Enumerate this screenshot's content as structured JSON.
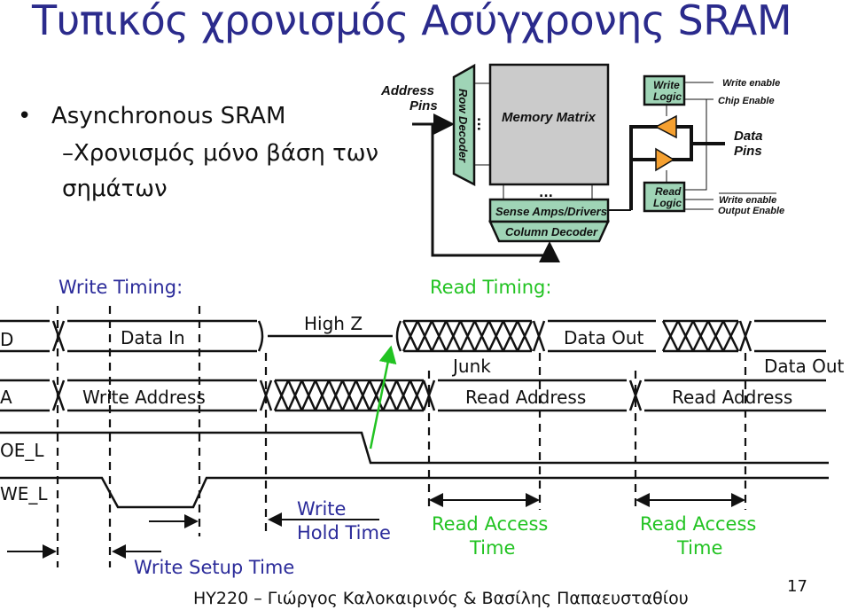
{
  "slide": {
    "title": "Τυπικός χρονισμός Ασύγχρονης SRAM",
    "bullet": "Asynchronous SRAM",
    "sub_bullet_line1": "–Χρονισμός μόνο βάση των",
    "sub_bullet_line2": "σημάτων",
    "footer": "ΗΥ220 – Γιώργος Καλοκαιρινός & Βασίλης Παπαευσταθίου",
    "page_number": "17",
    "title_color": "#2b2b8c"
  },
  "block_diagram": {
    "address_pins": [
      "Address",
      "Pins"
    ],
    "row_decoder": "Row Decoder",
    "memory_matrix": "Memory Matrix",
    "sense_amps": "Sense Amps/Drivers",
    "column_decoder": "Column Decoder",
    "write_logic": [
      "Write",
      "Logic"
    ],
    "read_logic": [
      "Read",
      "Logic"
    ],
    "data_pins": [
      "Data",
      "Pins"
    ],
    "write_enable": "Write enable",
    "chip_enable": "Chip Enable",
    "write_enable_bar": "Write enable",
    "output_enable": "Output Enable",
    "dots": "...",
    "block_color": "#9fd4b6",
    "matrix_color": "#cbcbcb",
    "buffer_color": "#f5a030"
  },
  "timing": {
    "write_timing_label": "Write Timing:",
    "read_timing_label": "Read Timing:",
    "signals": [
      "D",
      "A",
      "OE_L",
      "WE_L"
    ],
    "data_in": "Data In",
    "high_z": "High Z",
    "data_out_1": "Data Out",
    "junk": "Junk",
    "data_out_2": "Data Out",
    "write_address": "Write Address",
    "read_address_1": "Read Address",
    "read_address_2": "Read Address",
    "write_hold_line1": "Write",
    "write_hold_line2": "Hold Time",
    "write_setup": "Write Setup Time",
    "read_access_1_line1": "Read Access",
    "read_access_1_line2": "Time",
    "read_access_2_line1": "Read Access",
    "read_access_2_line2": "Time",
    "write_color": "#2b2b9a",
    "read_color": "#22c322"
  }
}
